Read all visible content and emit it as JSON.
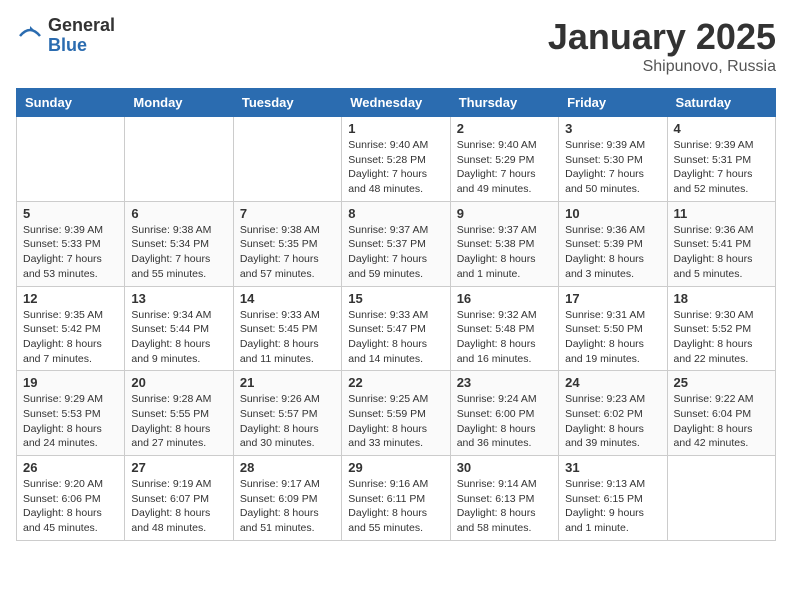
{
  "header": {
    "logo_general": "General",
    "logo_blue": "Blue",
    "title": "January 2025",
    "location": "Shipunovo, Russia"
  },
  "weekdays": [
    "Sunday",
    "Monday",
    "Tuesday",
    "Wednesday",
    "Thursday",
    "Friday",
    "Saturday"
  ],
  "weeks": [
    [
      {
        "day": "",
        "sunrise": "",
        "sunset": "",
        "daylight": ""
      },
      {
        "day": "",
        "sunrise": "",
        "sunset": "",
        "daylight": ""
      },
      {
        "day": "",
        "sunrise": "",
        "sunset": "",
        "daylight": ""
      },
      {
        "day": "1",
        "sunrise": "Sunrise: 9:40 AM",
        "sunset": "Sunset: 5:28 PM",
        "daylight": "Daylight: 7 hours and 48 minutes."
      },
      {
        "day": "2",
        "sunrise": "Sunrise: 9:40 AM",
        "sunset": "Sunset: 5:29 PM",
        "daylight": "Daylight: 7 hours and 49 minutes."
      },
      {
        "day": "3",
        "sunrise": "Sunrise: 9:39 AM",
        "sunset": "Sunset: 5:30 PM",
        "daylight": "Daylight: 7 hours and 50 minutes."
      },
      {
        "day": "4",
        "sunrise": "Sunrise: 9:39 AM",
        "sunset": "Sunset: 5:31 PM",
        "daylight": "Daylight: 7 hours and 52 minutes."
      }
    ],
    [
      {
        "day": "5",
        "sunrise": "Sunrise: 9:39 AM",
        "sunset": "Sunset: 5:33 PM",
        "daylight": "Daylight: 7 hours and 53 minutes."
      },
      {
        "day": "6",
        "sunrise": "Sunrise: 9:38 AM",
        "sunset": "Sunset: 5:34 PM",
        "daylight": "Daylight: 7 hours and 55 minutes."
      },
      {
        "day": "7",
        "sunrise": "Sunrise: 9:38 AM",
        "sunset": "Sunset: 5:35 PM",
        "daylight": "Daylight: 7 hours and 57 minutes."
      },
      {
        "day": "8",
        "sunrise": "Sunrise: 9:37 AM",
        "sunset": "Sunset: 5:37 PM",
        "daylight": "Daylight: 7 hours and 59 minutes."
      },
      {
        "day": "9",
        "sunrise": "Sunrise: 9:37 AM",
        "sunset": "Sunset: 5:38 PM",
        "daylight": "Daylight: 8 hours and 1 minute."
      },
      {
        "day": "10",
        "sunrise": "Sunrise: 9:36 AM",
        "sunset": "Sunset: 5:39 PM",
        "daylight": "Daylight: 8 hours and 3 minutes."
      },
      {
        "day": "11",
        "sunrise": "Sunrise: 9:36 AM",
        "sunset": "Sunset: 5:41 PM",
        "daylight": "Daylight: 8 hours and 5 minutes."
      }
    ],
    [
      {
        "day": "12",
        "sunrise": "Sunrise: 9:35 AM",
        "sunset": "Sunset: 5:42 PM",
        "daylight": "Daylight: 8 hours and 7 minutes."
      },
      {
        "day": "13",
        "sunrise": "Sunrise: 9:34 AM",
        "sunset": "Sunset: 5:44 PM",
        "daylight": "Daylight: 8 hours and 9 minutes."
      },
      {
        "day": "14",
        "sunrise": "Sunrise: 9:33 AM",
        "sunset": "Sunset: 5:45 PM",
        "daylight": "Daylight: 8 hours and 11 minutes."
      },
      {
        "day": "15",
        "sunrise": "Sunrise: 9:33 AM",
        "sunset": "Sunset: 5:47 PM",
        "daylight": "Daylight: 8 hours and 14 minutes."
      },
      {
        "day": "16",
        "sunrise": "Sunrise: 9:32 AM",
        "sunset": "Sunset: 5:48 PM",
        "daylight": "Daylight: 8 hours and 16 minutes."
      },
      {
        "day": "17",
        "sunrise": "Sunrise: 9:31 AM",
        "sunset": "Sunset: 5:50 PM",
        "daylight": "Daylight: 8 hours and 19 minutes."
      },
      {
        "day": "18",
        "sunrise": "Sunrise: 9:30 AM",
        "sunset": "Sunset: 5:52 PM",
        "daylight": "Daylight: 8 hours and 22 minutes."
      }
    ],
    [
      {
        "day": "19",
        "sunrise": "Sunrise: 9:29 AM",
        "sunset": "Sunset: 5:53 PM",
        "daylight": "Daylight: 8 hours and 24 minutes."
      },
      {
        "day": "20",
        "sunrise": "Sunrise: 9:28 AM",
        "sunset": "Sunset: 5:55 PM",
        "daylight": "Daylight: 8 hours and 27 minutes."
      },
      {
        "day": "21",
        "sunrise": "Sunrise: 9:26 AM",
        "sunset": "Sunset: 5:57 PM",
        "daylight": "Daylight: 8 hours and 30 minutes."
      },
      {
        "day": "22",
        "sunrise": "Sunrise: 9:25 AM",
        "sunset": "Sunset: 5:59 PM",
        "daylight": "Daylight: 8 hours and 33 minutes."
      },
      {
        "day": "23",
        "sunrise": "Sunrise: 9:24 AM",
        "sunset": "Sunset: 6:00 PM",
        "daylight": "Daylight: 8 hours and 36 minutes."
      },
      {
        "day": "24",
        "sunrise": "Sunrise: 9:23 AM",
        "sunset": "Sunset: 6:02 PM",
        "daylight": "Daylight: 8 hours and 39 minutes."
      },
      {
        "day": "25",
        "sunrise": "Sunrise: 9:22 AM",
        "sunset": "Sunset: 6:04 PM",
        "daylight": "Daylight: 8 hours and 42 minutes."
      }
    ],
    [
      {
        "day": "26",
        "sunrise": "Sunrise: 9:20 AM",
        "sunset": "Sunset: 6:06 PM",
        "daylight": "Daylight: 8 hours and 45 minutes."
      },
      {
        "day": "27",
        "sunrise": "Sunrise: 9:19 AM",
        "sunset": "Sunset: 6:07 PM",
        "daylight": "Daylight: 8 hours and 48 minutes."
      },
      {
        "day": "28",
        "sunrise": "Sunrise: 9:17 AM",
        "sunset": "Sunset: 6:09 PM",
        "daylight": "Daylight: 8 hours and 51 minutes."
      },
      {
        "day": "29",
        "sunrise": "Sunrise: 9:16 AM",
        "sunset": "Sunset: 6:11 PM",
        "daylight": "Daylight: 8 hours and 55 minutes."
      },
      {
        "day": "30",
        "sunrise": "Sunrise: 9:14 AM",
        "sunset": "Sunset: 6:13 PM",
        "daylight": "Daylight: 8 hours and 58 minutes."
      },
      {
        "day": "31",
        "sunrise": "Sunrise: 9:13 AM",
        "sunset": "Sunset: 6:15 PM",
        "daylight": "Daylight: 9 hours and 1 minute."
      },
      {
        "day": "",
        "sunrise": "",
        "sunset": "",
        "daylight": ""
      }
    ]
  ]
}
